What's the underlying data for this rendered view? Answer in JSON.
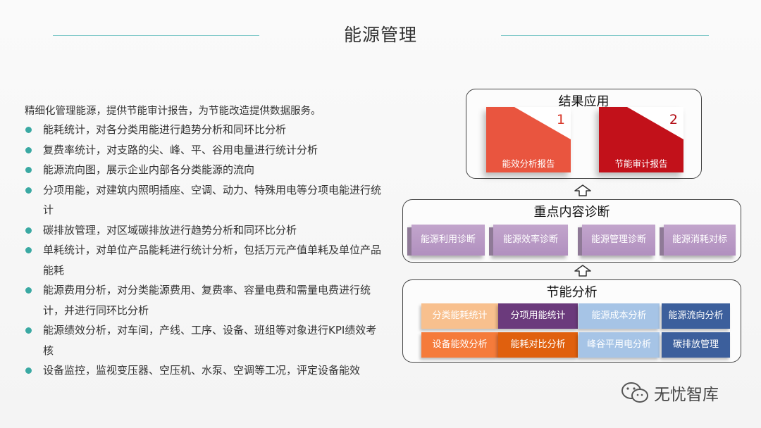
{
  "title": "能源管理",
  "intro": "精细化管理能源，提供节能审计报告，为节能改造提供数据服务。",
  "bullets": [
    "能耗统计，对各分类用能进行趋势分析和同环比分析",
    "复费率统计，对支路的尖、峰、平、谷用电量进行统计分析",
    "能源流向图，展示企业内部各分类能源的流向",
    "分项用能，对建筑内照明插座、空调、动力、特殊用电等分项电能进行统计",
    "碳排放管理，对区域碳排放进行趋势分析和同环比分析",
    "单耗统计，对单位产品能耗进行统计分析，包括万元产值单耗及单位产品能耗",
    "能源费用分析，对分类能源费用、复费率、容量电费和需量电费进行统计，并进行同环比分析",
    "能源绩效分析，对车间，产线、工序、设备、班组等对象进行KPI绩效考核",
    "设备监控，监视变压器、空压机、水泵、空调等工况，评定设备能效"
  ],
  "results": {
    "title": "结果应用",
    "items": [
      {
        "num": "1",
        "label": "能效分析报告"
      },
      {
        "num": "2",
        "label": "节能审计报告"
      }
    ]
  },
  "diagnosis": {
    "title": "重点内容诊断",
    "items": [
      "能源利用诊断",
      "能源效率诊断",
      "能源管理诊断",
      "能源消耗对标"
    ]
  },
  "analysis": {
    "title": "节能分析",
    "row1": [
      "分类能耗统计",
      "分项用能统计",
      "能源成本分析",
      "能源流向分析"
    ],
    "row2": [
      "设备能效分析",
      "能耗对比分析",
      "峰谷平用电分析",
      "碳排放管理"
    ]
  },
  "colors": {
    "row1": [
      "#f8c08e",
      "#6b3a7c",
      "#a6c4e6",
      "#3c5f9c"
    ],
    "row2": [
      "#f57b3b",
      "#e0600e",
      "#a6c4e6",
      "#3c5f9c"
    ]
  },
  "watermark": "无忧智库"
}
